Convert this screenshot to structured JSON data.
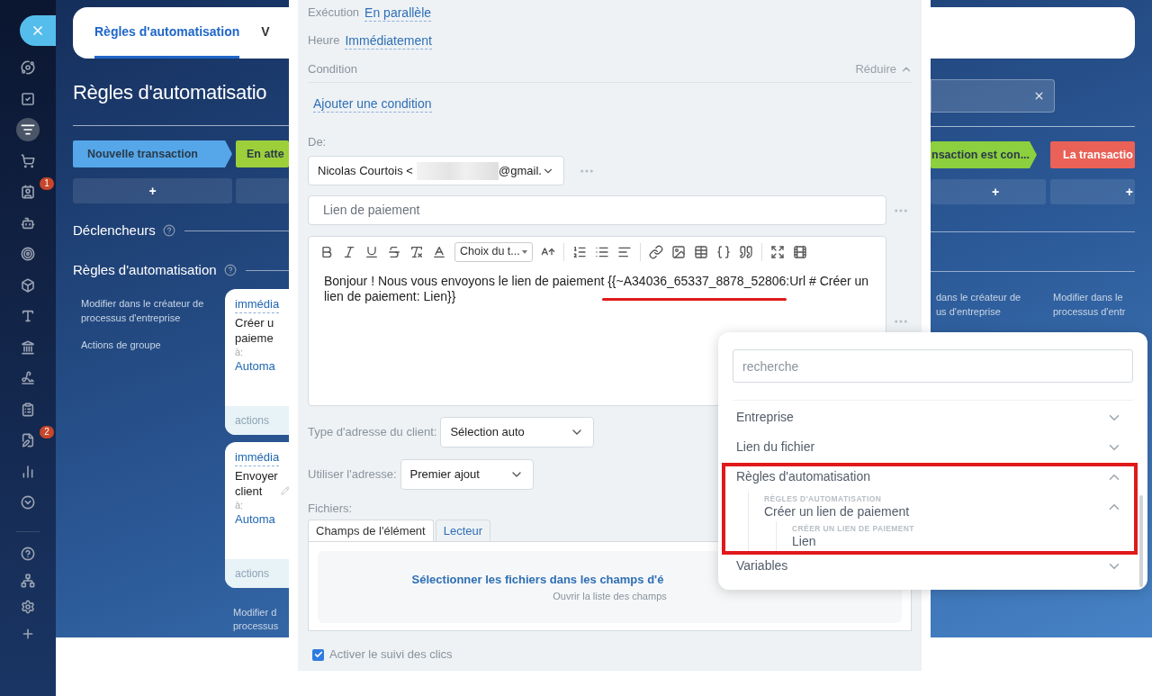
{
  "sidebar": {
    "items": [
      {
        "selected": false
      },
      {
        "selected": false
      },
      {
        "selected": true
      },
      {
        "selected": false
      },
      {
        "selected": false,
        "badge": "1"
      },
      {
        "selected": false
      },
      {
        "selected": false
      },
      {
        "selected": false
      },
      {
        "selected": false
      },
      {
        "selected": false
      },
      {
        "selected": false
      },
      {
        "selected": false
      },
      {
        "selected": false,
        "badge": "2"
      },
      {
        "selected": false
      },
      {
        "selected": false
      }
    ],
    "bottom_items": [
      {
        "selected": false
      },
      {
        "selected": false
      },
      {
        "selected": false
      },
      {
        "selected": false
      }
    ]
  },
  "background_left": {
    "tabs": [
      {
        "label": "Règles d'automatisation",
        "selected": true
      },
      {
        "label": "V",
        "selected": false
      }
    ],
    "title": "Règles d'automatisatio",
    "stages": [
      {
        "label": "Nouvelle transaction",
        "color": "#55a7e9",
        "arrow": true,
        "add_label": "+"
      },
      {
        "label": "En atte",
        "color": "#9dcf3a",
        "arrow": false
      }
    ],
    "sections": [
      "Déclencheurs",
      "Règles d'automatisation"
    ],
    "side_links": [
      "Modifier dans le créateur de processus d'entreprise",
      "Actions de groupe"
    ],
    "cards": [
      {
        "timing": "immédia",
        "title": "Créer u\npaieme",
        "editable": false,
        "to_label": "à:",
        "target": "Automa",
        "footer": "actions"
      },
      {
        "timing": "immédia",
        "title": "Envoyer\nclient",
        "editable": true,
        "to_label": "à:",
        "target": "Automa",
        "footer": "actions"
      }
    ],
    "footer_link": "Modifier d\nprocessus"
  },
  "background_right": {
    "stages": [
      {
        "label": "nsaction est con...",
        "color": "#8ccf3f",
        "arrow": true,
        "add_label": "+"
      },
      {
        "label": "La transactio",
        "color": "#ea6157",
        "arrow": false,
        "add_label": "+"
      }
    ],
    "side_links": [
      "dans le créateur de\nus d'entreprise",
      "Modifier dans le\nprocessus d'entr"
    ]
  },
  "panel": {
    "execution": {
      "label": "Exécution",
      "value": "En parallèle"
    },
    "time": {
      "label": "Heure",
      "value": "Immédiatement"
    },
    "condition": {
      "label": "Condition",
      "collapse": "Réduire",
      "add": "Ajouter une condition"
    },
    "sender": {
      "label": "De:",
      "name": "Nicolas Courtois <",
      "domain": "@gmail."
    },
    "subject": {
      "value": "Lien de paiement"
    },
    "editor": {
      "font_select": "Choix du t...",
      "body": "Bonjour ! Nous vous envoyons le lien de paiement {{~A34036_65337_8878_52806:Url # Créer un lien de paiement: Lien}}"
    },
    "address_type": {
      "label": "Type d'adresse du client:",
      "value": "Sélection auto"
    },
    "use_address": {
      "label": "Utiliser l'adresse:",
      "value": "Premier ajout"
    },
    "files": {
      "label": "Fichiers:",
      "tabs": [
        {
          "label": "Champs de l'élément",
          "selected": true
        },
        {
          "label": "Lecteur",
          "selected": false
        }
      ],
      "action": "Sélectionner les fichiers dans les champs d'é",
      "hint": "Ouvrir la liste des champs"
    },
    "click_tracking": {
      "label": "Activer le suivi des clics",
      "checked": true
    }
  },
  "variables_menu": {
    "search": {
      "placeholder": "recherche"
    },
    "items": [
      {
        "label": "Entreprise",
        "expanded": false
      },
      {
        "label": "Lien du fichier",
        "expanded": false
      },
      {
        "label": "Règles d'automatisation",
        "expanded": true,
        "children": [
          {
            "group_label": "RÈGLES D'AUTOMATISATION",
            "label": "Créer un lien de paiement",
            "expanded": true,
            "children": [
              {
                "group_label": "CRÉER UN LIEN DE PAIEMENT",
                "label": "Lien"
              }
            ]
          }
        ]
      },
      {
        "label": "Variables",
        "expanded": false
      }
    ]
  }
}
